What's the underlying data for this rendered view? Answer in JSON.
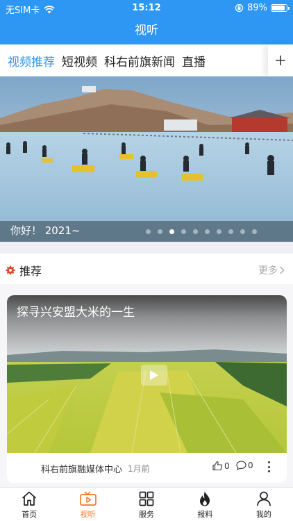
{
  "status_bar": {
    "carrier": "无SIM卡",
    "time": "15:12",
    "battery": "89%",
    "battery_level": 0.89
  },
  "nav": {
    "title": "视听"
  },
  "tabs": [
    {
      "label": "视频推荐",
      "active": true
    },
    {
      "label": "短视频",
      "active": false
    },
    {
      "label": "科右前旗新闻",
      "active": false
    },
    {
      "label": "直播",
      "active": false
    }
  ],
  "banner": {
    "caption": "你好！ 2021~",
    "slide_count": 10,
    "active_slide": 3
  },
  "section": {
    "title": "推荐",
    "more": "更多"
  },
  "card": {
    "title": "探寻兴安盟大米的一生",
    "source": "科右前旗融媒体中心",
    "date": "1月前",
    "likes": "0",
    "comments": "0"
  },
  "tabbar": [
    {
      "label": "首页",
      "icon": "home-icon",
      "active": false
    },
    {
      "label": "视听",
      "icon": "video-tv-icon",
      "active": true
    },
    {
      "label": "服务",
      "icon": "grid-icon",
      "active": false
    },
    {
      "label": "报料",
      "icon": "fire-icon",
      "active": false
    },
    {
      "label": "我的",
      "icon": "user-icon",
      "active": false
    }
  ],
  "colors": {
    "primary": "#2d97f3",
    "accent": "#f0782a",
    "badge": "#e2462a"
  }
}
